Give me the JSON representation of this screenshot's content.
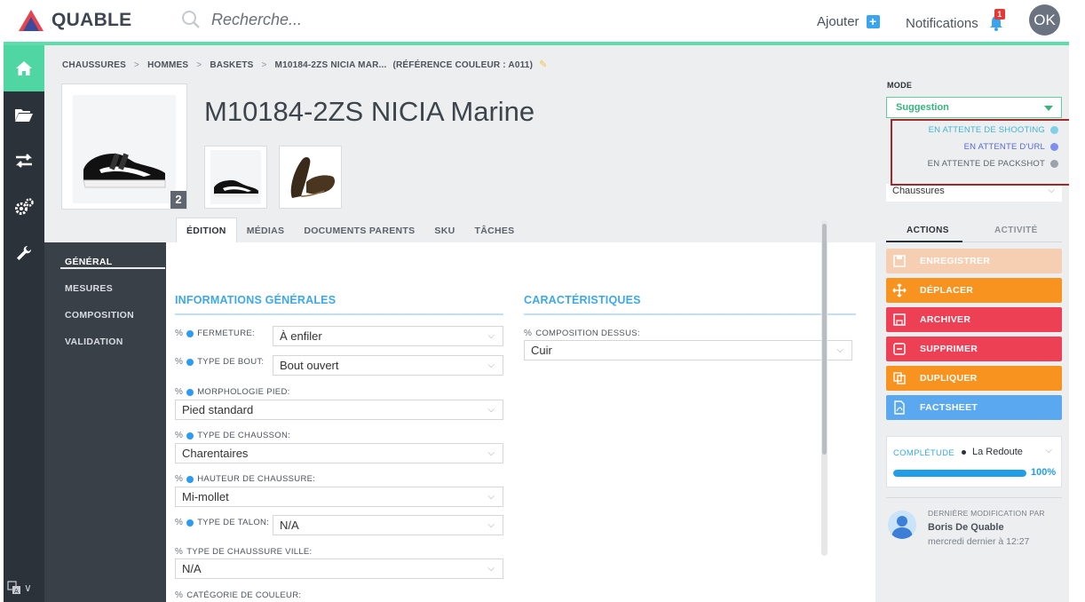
{
  "app": {
    "brand": "QUABLE",
    "search_placeholder": "Recherche...",
    "add_label": "Ajouter",
    "notifications_label": "Notifications",
    "notifications_count": "1",
    "user_initials": "OK"
  },
  "sidebar": {
    "items": [
      {
        "icon": "home-icon",
        "active": true
      },
      {
        "icon": "folder-open-icon",
        "active": false
      },
      {
        "icon": "transfer-arrows-icon",
        "active": false
      },
      {
        "icon": "gears-icon",
        "active": false
      },
      {
        "icon": "wrench-icon",
        "active": false
      }
    ],
    "language_icon": "translate-icon"
  },
  "breadcrumb": {
    "items": [
      "CHAUSSURES",
      "HOMMES",
      "BASKETS",
      "M10184-2ZS NICIA MAR...",
      "(RÉFÉRENCE COULEUR : A011)"
    ],
    "separator": ">"
  },
  "product": {
    "title": "M10184-2ZS NICIA Marine",
    "image_count": "2"
  },
  "tabs": [
    "ÉDITION",
    "MÉDIAS",
    "DOCUMENTS PARENTS",
    "SKU",
    "TÂCHES"
  ],
  "subnav": [
    "GÉNÉRAL",
    "MESURES",
    "COMPOSITION",
    "VALIDATION"
  ],
  "general": {
    "section_title": "INFORMATIONS GÉNÉRALES",
    "fields": [
      {
        "label": "FERMETURE:",
        "value": "À enfiler"
      },
      {
        "label": "TYPE DE BOUT:",
        "value": "Bout ouvert"
      },
      {
        "label": "MORPHOLOGIE PIED:",
        "value": "Pied standard"
      },
      {
        "label": "TYPE DE CHAUSSON:",
        "value": "Charentaires"
      },
      {
        "label": "HAUTEUR DE CHAUSSURE:",
        "value": "Mi-mollet"
      },
      {
        "label": "TYPE DE TALON:",
        "value": "N/A"
      },
      {
        "label": "TYPE DE CHAUSSURE VILLE:",
        "value": "N/A"
      },
      {
        "label": "CATÉGORIE DE COULEUR:",
        "value": ""
      }
    ]
  },
  "characteristics": {
    "section_title": "CARACTÉRISTIQUES",
    "fields": [
      {
        "label": "COMPOSITION DESSUS:",
        "value": "Cuir"
      }
    ]
  },
  "mode": {
    "label": "MODE",
    "selected": "Suggestion",
    "statuses": [
      {
        "label": "EN ATTENTE DE SHOOTING",
        "color": "#7fd1e9",
        "text_color": "#3fb6da"
      },
      {
        "label": "EN ATTENTE D'URL",
        "color": "#7f8ff0",
        "text_color": "#5a6ad6"
      },
      {
        "label": "EN ATTENTE DE PACKSHOT",
        "color": "#9ba2ab",
        "text_color": "#5b6470"
      }
    ],
    "category_value": "Chaussures"
  },
  "right_tabs": [
    "ACTIONS",
    "ACTIVITÉ"
  ],
  "actions": [
    {
      "label": "ENREGISTRER",
      "icon": "save-icon",
      "color": "#f6cfb3"
    },
    {
      "label": "DÉPLACER",
      "icon": "move-icon",
      "color": "#f7931e"
    },
    {
      "label": "ARCHIVER",
      "icon": "archive-icon",
      "color": "#ee4055"
    },
    {
      "label": "SUPPRIMER",
      "icon": "delete-icon",
      "color": "#ee4055"
    },
    {
      "label": "DUPLIQUER",
      "icon": "duplicate-icon",
      "color": "#f7931e"
    },
    {
      "label": "FACTSHEET",
      "icon": "pdf-icon",
      "color": "#5aa8f0"
    }
  ],
  "completeness": {
    "label": "COMPLÉTUDE",
    "channel": "La Redoute",
    "percent_label": "100%",
    "fraction": 1.0
  },
  "last_modified": {
    "heading": "DERNIÈRE MODIFICATION PAR",
    "user": "Boris De Quable",
    "when": "mercredi dernier à 12:27"
  }
}
